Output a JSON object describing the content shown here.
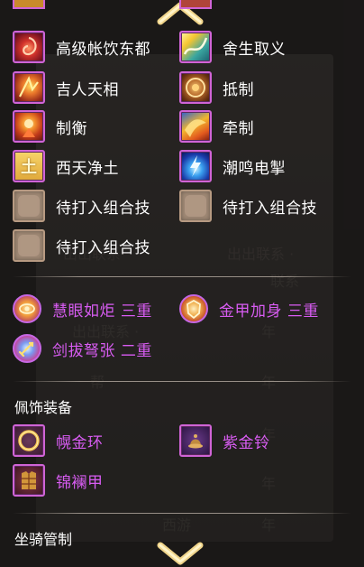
{
  "skills": [
    {
      "label": "高级帐饮东都",
      "icon": "crimson-swirl-icon"
    },
    {
      "label": "舍生取义",
      "icon": "golden-wave-icon"
    },
    {
      "label": "吉人天相",
      "icon": "fire-creature-icon"
    },
    {
      "label": "抵制",
      "icon": "bronze-shield-icon"
    },
    {
      "label": "制衡",
      "icon": "flame-warrior-icon"
    },
    {
      "label": "牵制",
      "icon": "phoenix-icon"
    },
    {
      "label": "西天净土",
      "icon": "earth-tile-icon",
      "glyph": "土"
    },
    {
      "label": "潮鸣电掣",
      "icon": "blue-lightning-icon"
    },
    {
      "label": "待打入组合技",
      "icon": "empty-slot-icon"
    },
    {
      "label": "待打入组合技",
      "icon": "empty-slot-icon"
    },
    {
      "label": "待打入组合技",
      "icon": "empty-slot-icon"
    }
  ],
  "buffs": [
    {
      "label": "慧眼如炬 三重",
      "icon": "eye-orb-icon"
    },
    {
      "label": "金甲加身 三重",
      "icon": "golden-armor-orb-icon"
    },
    {
      "label": "剑拔弩张 二重",
      "icon": "sword-orb-icon"
    }
  ],
  "accessories": {
    "title": "佩饰装备",
    "items": [
      {
        "label": "幌金环",
        "icon": "gold-ring-icon"
      },
      {
        "label": "紫金铃",
        "icon": "purple-bell-icon"
      },
      {
        "label": "锦襕甲",
        "icon": "brocade-armor-icon"
      }
    ]
  },
  "mount": {
    "title": "坐骑管制"
  },
  "background_text": [
    "出出联系 ·",
    "出出联系 ·",
    "年",
    "年",
    "帮",
    "年",
    "年",
    "年",
    "出出联系",
    "联系",
    "西游"
  ],
  "colors": {
    "purple_text": "#d85cf2",
    "icon_border": "#d064d6",
    "panel_bg": "#262321"
  }
}
